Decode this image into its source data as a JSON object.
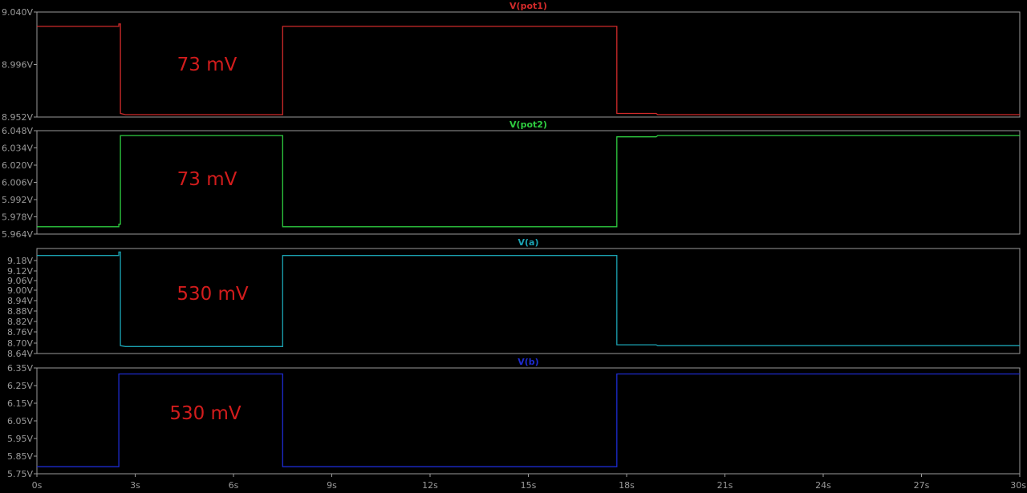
{
  "colors": {
    "background": "#000000",
    "frame": "#9a9a9a",
    "tick_text": "#9a9a9a",
    "annotation": "#d21c1c"
  },
  "chart_data": [
    {
      "type": "line",
      "title": "V(pot1)",
      "color": "#d12a2a",
      "xlim": [
        0,
        30
      ],
      "ylim": [
        8.952,
        9.04
      ],
      "yticks": [
        "9.040V",
        "8.996V",
        "8.952V"
      ],
      "annotation": "73 mV",
      "series": [
        {
          "name": "V(pot1)",
          "x": [
            0,
            2.5,
            2.5,
            2.55,
            2.55,
            2.7,
            7.5,
            7.5,
            17.7,
            17.7,
            18.9,
            18.95,
            30
          ],
          "y": [
            9.028,
            9.028,
            9.03,
            9.03,
            8.955,
            8.954,
            8.954,
            9.028,
            9.028,
            8.955,
            8.955,
            8.954,
            8.954
          ]
        }
      ]
    },
    {
      "type": "line",
      "title": "V(pot2)",
      "color": "#2ecc40",
      "xlim": [
        0,
        30
      ],
      "ylim": [
        5.964,
        6.048
      ],
      "yticks": [
        "6.048V",
        "6.034V",
        "6.020V",
        "6.006V",
        "5.992V",
        "5.978V",
        "5.964V"
      ],
      "annotation": "73 mV",
      "series": [
        {
          "name": "V(pot2)",
          "x": [
            0,
            2.5,
            2.5,
            2.55,
            2.55,
            7.5,
            7.5,
            17.7,
            17.7,
            18.9,
            18.95,
            30
          ],
          "y": [
            5.97,
            5.97,
            5.972,
            5.972,
            6.044,
            6.044,
            5.97,
            5.97,
            6.043,
            6.043,
            6.044,
            6.044
          ]
        }
      ]
    },
    {
      "type": "line",
      "title": "V(a)",
      "color": "#1ba3b3",
      "xlim": [
        0,
        30
      ],
      "ylim": [
        8.64,
        9.24
      ],
      "yticks": [
        "9.18V",
        "9.12V",
        "9.06V",
        "9.00V",
        "8.94V",
        "8.88V",
        "8.82V",
        "8.76V",
        "8.70V",
        "8.64V"
      ],
      "annotation": "530 mV",
      "series": [
        {
          "name": "V(a)",
          "x": [
            0,
            2.5,
            2.5,
            2.55,
            2.55,
            2.7,
            7.5,
            7.5,
            17.7,
            17.7,
            18.9,
            18.95,
            30
          ],
          "y": [
            9.2,
            9.2,
            9.22,
            9.22,
            8.685,
            8.68,
            8.68,
            9.2,
            9.2,
            8.69,
            8.69,
            8.685,
            8.685
          ]
        }
      ]
    },
    {
      "type": "line",
      "title": "V(b)",
      "color": "#1d2bd0",
      "xlim": [
        0,
        30
      ],
      "ylim": [
        5.75,
        6.35
      ],
      "yticks": [
        "6.35V",
        "6.25V",
        "6.15V",
        "6.05V",
        "5.95V",
        "5.85V",
        "5.75V"
      ],
      "annotation": "530 mV",
      "series": [
        {
          "name": "V(b)",
          "x": [
            0,
            2.5,
            2.5,
            7.5,
            7.5,
            17.7,
            17.7,
            30
          ],
          "y": [
            5.79,
            5.79,
            6.316,
            6.316,
            5.79,
            5.79,
            6.316,
            6.316
          ]
        }
      ]
    }
  ],
  "xaxis": {
    "ticks": [
      0,
      3,
      6,
      9,
      12,
      15,
      18,
      21,
      24,
      27,
      30
    ],
    "tick_labels": [
      "0s",
      "3s",
      "6s",
      "9s",
      "12s",
      "15s",
      "18s",
      "21s",
      "24s",
      "27s",
      "30s"
    ]
  }
}
